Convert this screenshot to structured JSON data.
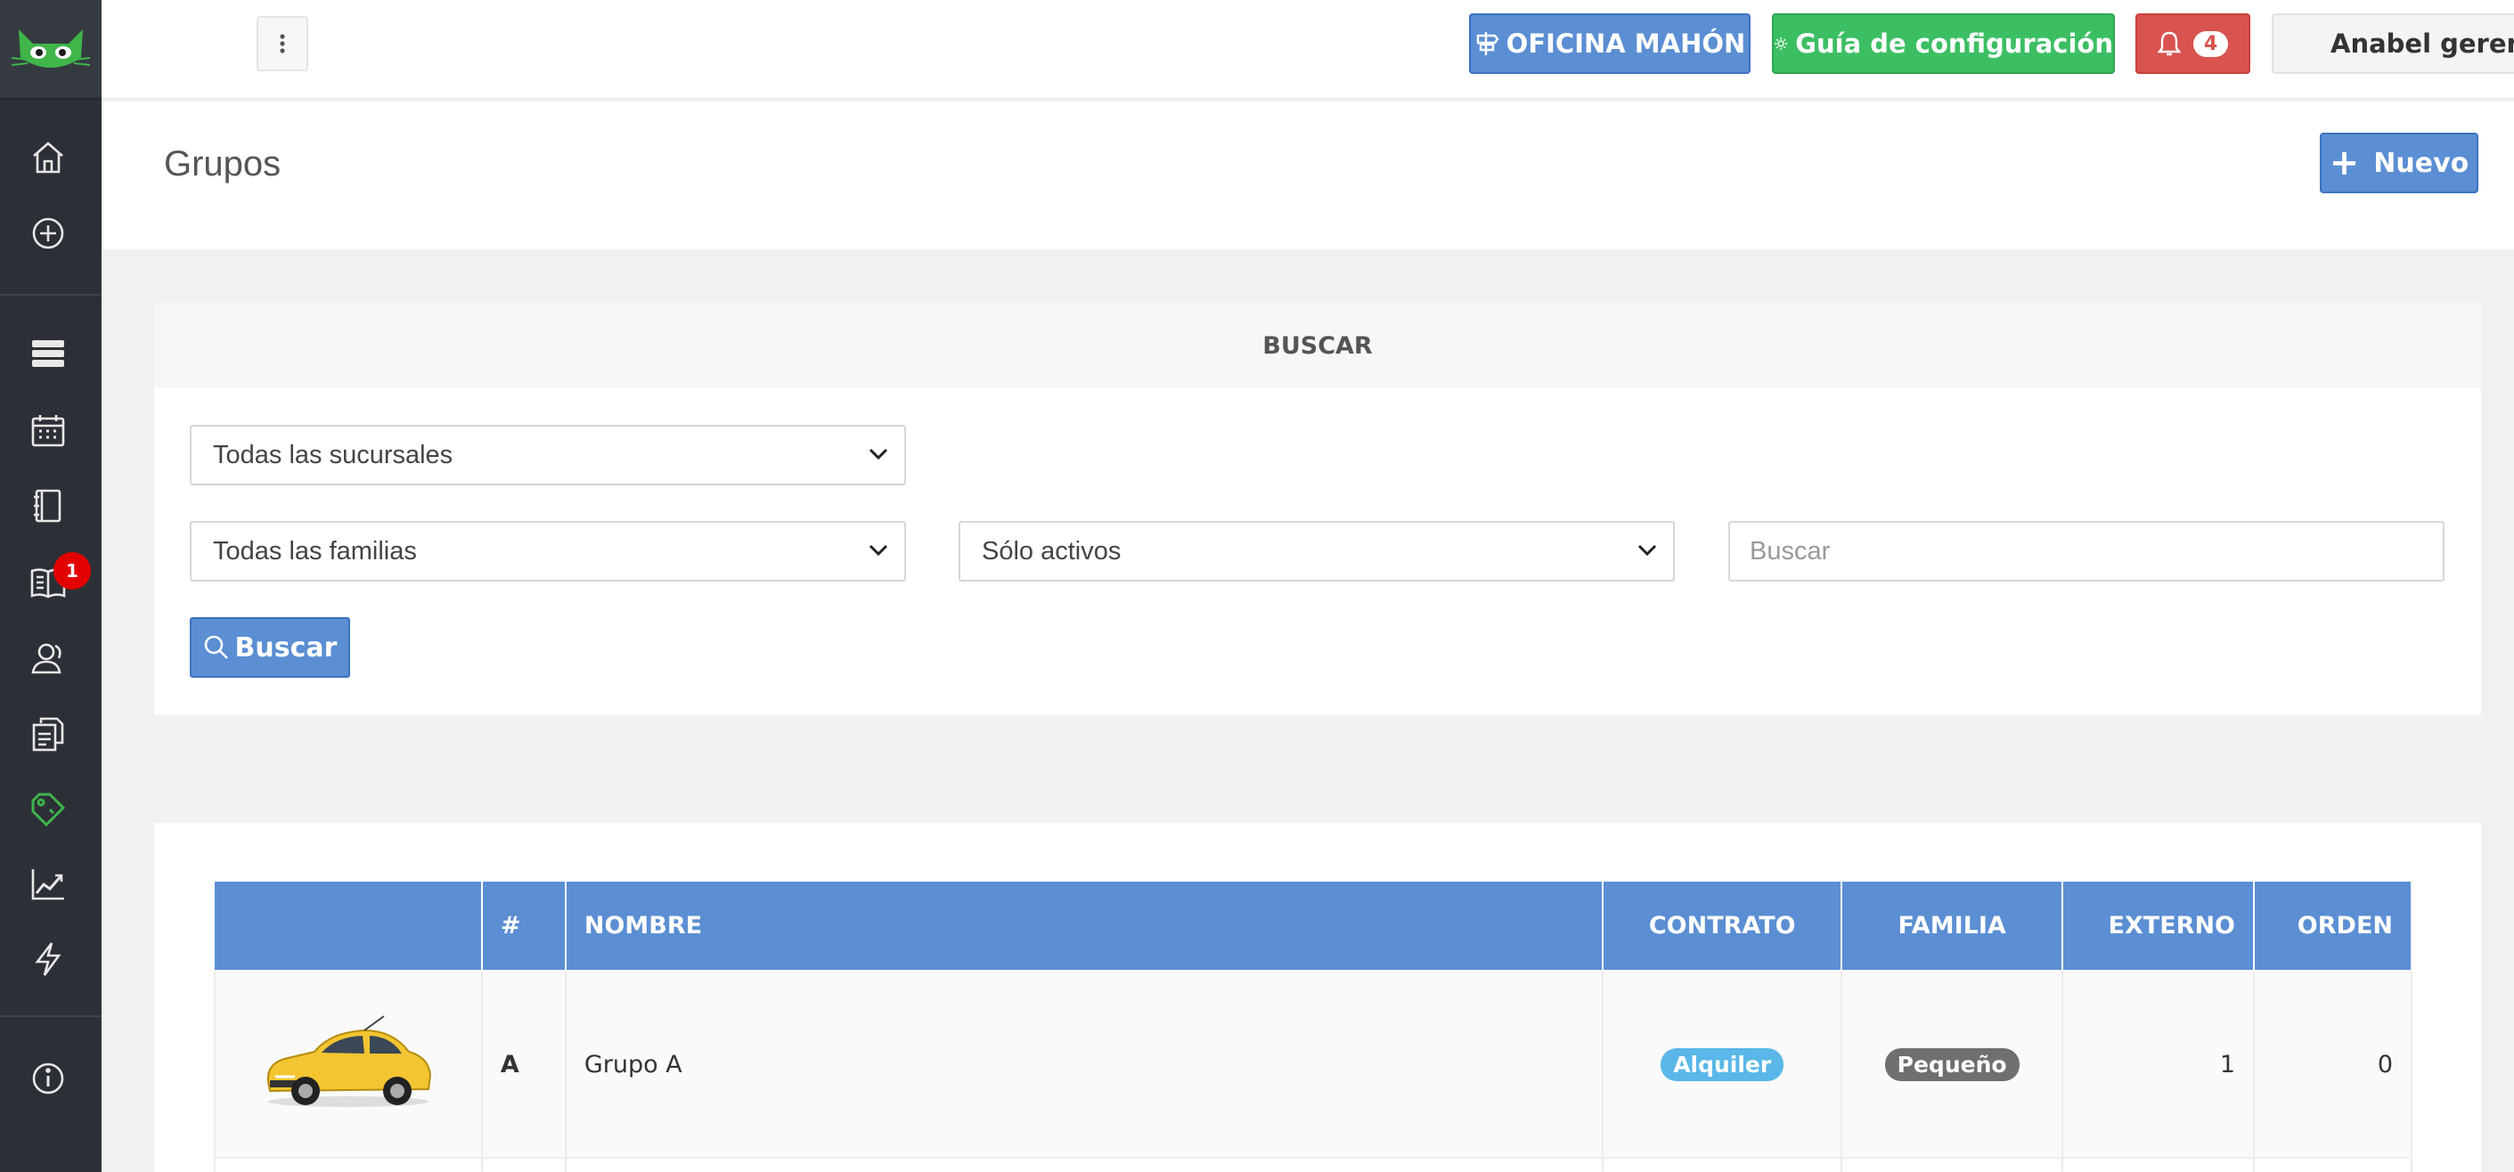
{
  "topbar": {
    "office_label": "OFICINA MAHÓN",
    "guide_label": "Guía de configuración",
    "notifications_count": "4",
    "user_name": "Anabel gerencia"
  },
  "sidebar": {
    "notification_badge": "1"
  },
  "page": {
    "title": "Grupos",
    "new_button_label": "Nuevo"
  },
  "search": {
    "panel_title": "BUSCAR",
    "branch_select_value": "Todas las sucursales",
    "family_select_value": "Todas las familias",
    "status_select_value": "Sólo activos",
    "search_placeholder": "Buscar",
    "search_button_label": "Buscar"
  },
  "table": {
    "columns": [
      "",
      "#",
      "NOMBRE",
      "CONTRATO",
      "FAMILIA",
      "EXTERNO",
      "ORDEN"
    ],
    "rows": [
      {
        "code": "A",
        "name": "Grupo A",
        "contract": "Alquiler",
        "family": "Pequeño",
        "external": "1",
        "order": "0"
      }
    ]
  },
  "colors": {
    "primary": "#5b8ed3",
    "success": "#3cbf63",
    "danger": "#d9534f",
    "sidebar": "#2c3036"
  }
}
